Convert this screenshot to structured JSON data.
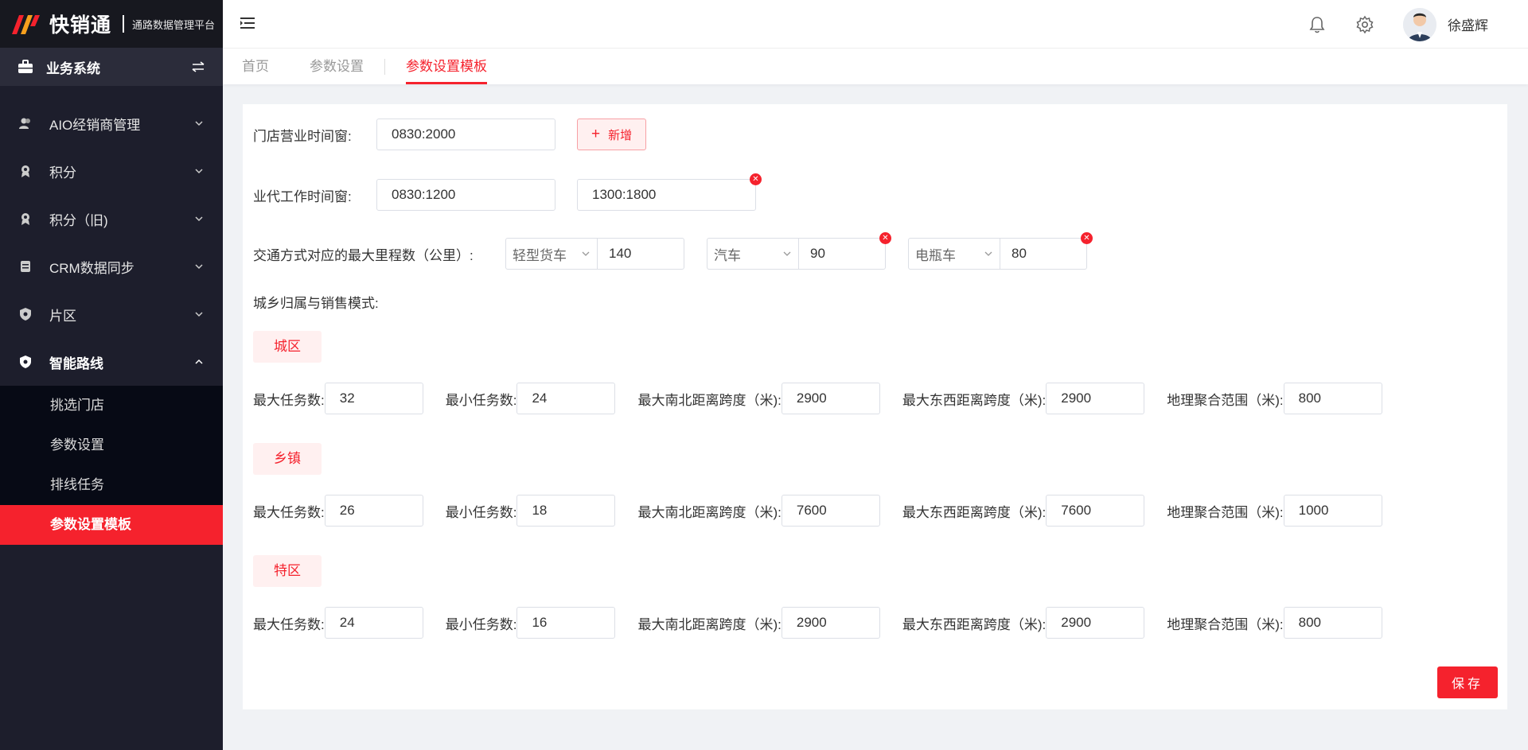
{
  "brand": {
    "name": "快销通",
    "subtitle": "通路数据管理平台"
  },
  "system": {
    "label": "业务系统"
  },
  "sidebar": {
    "items": [
      {
        "label": "AIO经销商管理",
        "icon": "users-icon"
      },
      {
        "label": "积分",
        "icon": "medal-icon"
      },
      {
        "label": "积分（旧)",
        "icon": "medal-icon"
      },
      {
        "label": "CRM数据同步",
        "icon": "document-icon"
      },
      {
        "label": "片区",
        "icon": "shield-icon"
      },
      {
        "label": "智能路线",
        "icon": "shield-icon"
      }
    ],
    "submenu": [
      {
        "label": "挑选门店"
      },
      {
        "label": "参数设置"
      },
      {
        "label": "排线任务"
      },
      {
        "label": "参数设置模板"
      }
    ]
  },
  "header": {
    "username": "徐盛辉"
  },
  "tabs": [
    {
      "label": "首页"
    },
    {
      "label": "参数设置"
    },
    {
      "label": "参数设置模板"
    }
  ],
  "form": {
    "store_hours_label": "门店营业时间窗:",
    "store_hours_value": "0830:2000",
    "add_label": "新增",
    "agent_hours_label": "业代工作时间窗:",
    "agent_hours_1": "0830:1200",
    "agent_hours_2": "1300:1800",
    "transport_label": "交通方式对应的最大里程数（公里）:",
    "transport": [
      {
        "type": "轻型货车",
        "value": "140"
      },
      {
        "type": "汽车",
        "value": "90"
      },
      {
        "type": "电瓶车",
        "value": "80"
      }
    ],
    "mode_label": "城乡归属与销售模式:",
    "field_labels": {
      "max_tasks": "最大任务数:",
      "min_tasks": "最小任务数:",
      "ns_span": "最大南北距离跨度（米):",
      "ew_span": "最大东西距离跨度（米):",
      "cluster": "地理聚合范围（米):"
    },
    "groups": [
      {
        "tag": "城区",
        "max_tasks": "32",
        "min_tasks": "24",
        "ns_span": "2900",
        "ew_span": "2900",
        "cluster": "800"
      },
      {
        "tag": "乡镇",
        "max_tasks": "26",
        "min_tasks": "18",
        "ns_span": "7600",
        "ew_span": "7600",
        "cluster": "1000"
      },
      {
        "tag": "特区",
        "max_tasks": "24",
        "min_tasks": "16",
        "ns_span": "2900",
        "ew_span": "2900",
        "cluster": "800"
      }
    ],
    "save_label": "保存"
  },
  "colors": {
    "accent": "#f5222d",
    "sidebar": "#1d1e2c",
    "submenu": "#070a15"
  }
}
